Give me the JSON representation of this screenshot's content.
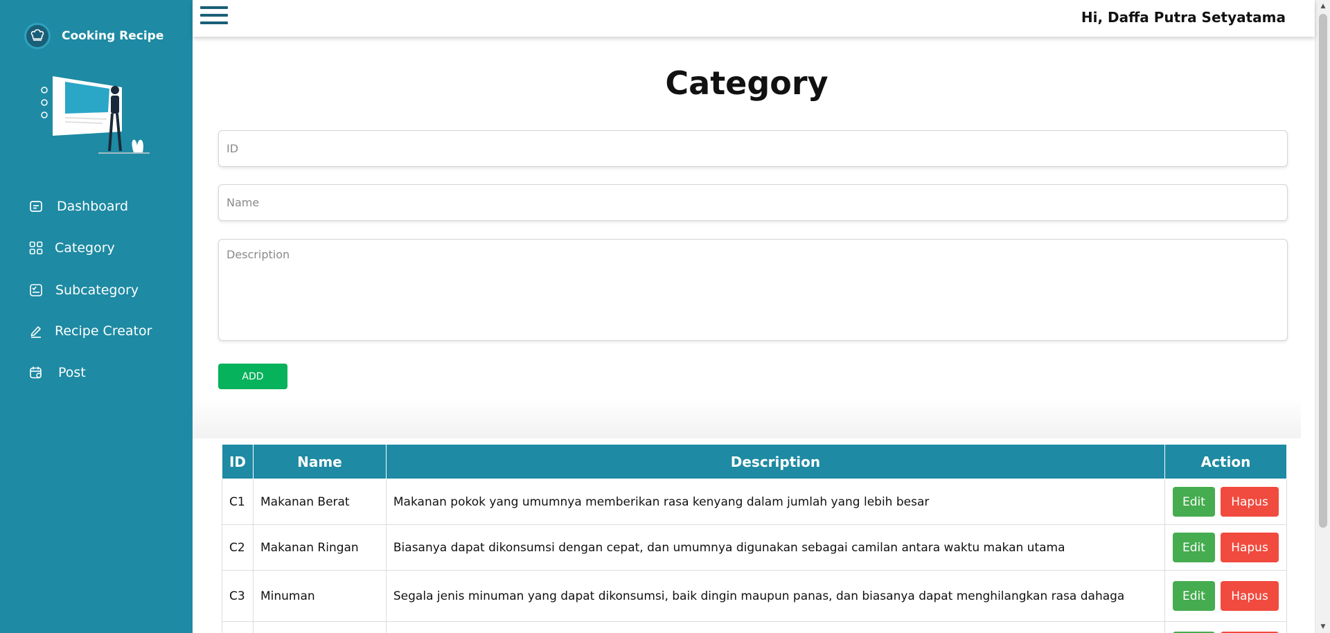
{
  "brand": {
    "title": "Cooking Recipe"
  },
  "sidebar": {
    "items": [
      {
        "label": "Dashboard",
        "icon": "dashboard-icon"
      },
      {
        "label": "Category",
        "icon": "grid-icon"
      },
      {
        "label": "Subcategory",
        "icon": "checklist-icon"
      },
      {
        "label": "Recipe Creator",
        "icon": "pencil-icon"
      },
      {
        "label": "Post",
        "icon": "calendar-icon"
      }
    ]
  },
  "header": {
    "greeting": "Hi, Daffa Putra Setyatama"
  },
  "page": {
    "title": "Category"
  },
  "form": {
    "id_placeholder": "ID",
    "name_placeholder": "Name",
    "description_placeholder": "Description",
    "add_label": "ADD"
  },
  "table": {
    "headers": {
      "id": "ID",
      "name": "Name",
      "description": "Description",
      "action": "Action"
    },
    "rows": [
      {
        "id": "C1",
        "name": "Makanan Berat",
        "description": "Makanan pokok yang umumnya memberikan rasa kenyang dalam jumlah yang lebih besar"
      },
      {
        "id": "C2",
        "name": "Makanan Ringan",
        "description": "Biasanya dapat dikonsumsi dengan cepat, dan umumnya digunakan sebagai camilan antara waktu makan utama"
      },
      {
        "id": "C3",
        "name": "Minuman",
        "description": "Segala jenis minuman yang dapat dikonsumsi, baik dingin maupun panas, dan biasanya dapat menghilangkan rasa dahaga"
      }
    ],
    "edit_label": "Edit",
    "delete_label": "Hapus"
  },
  "colors": {
    "sidebar": "#1e8aa3",
    "accent_dark": "#1a5f78",
    "add_button": "#06b25b",
    "edit_button": "#45ac4f",
    "delete_button": "#f14a3e"
  }
}
